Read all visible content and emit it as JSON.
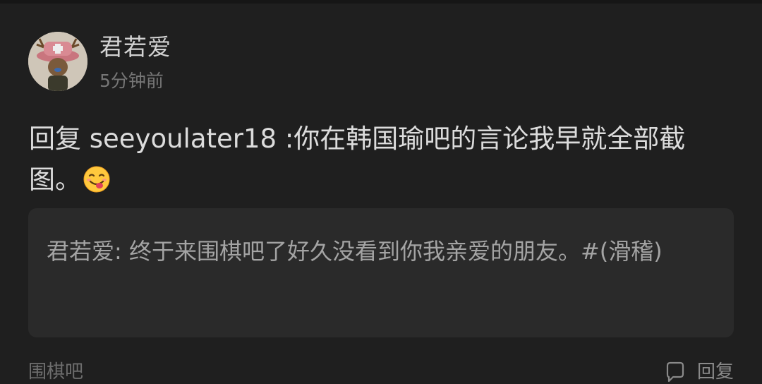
{
  "post": {
    "username": "君若爱",
    "timestamp": "5分钟前",
    "reply_text": "回复 seeyoulater18 :你在韩国瑜吧的言论我早就全部截图。",
    "emoji": "yum-face-emoji",
    "quote": "君若爱: 终于来围棋吧了好久没看到你我亲爱的朋友。#(滑稽)"
  },
  "footer": {
    "forum_name": "围棋吧",
    "reply_label": "回复"
  },
  "icons": {
    "avatar": "chopper-avatar",
    "reply": "reply-bubble-icon"
  },
  "colors": {
    "background": "#1f1f1f",
    "card": "#2a2a2a",
    "text_primary": "#dcdcdc",
    "text_secondary": "#767676"
  }
}
